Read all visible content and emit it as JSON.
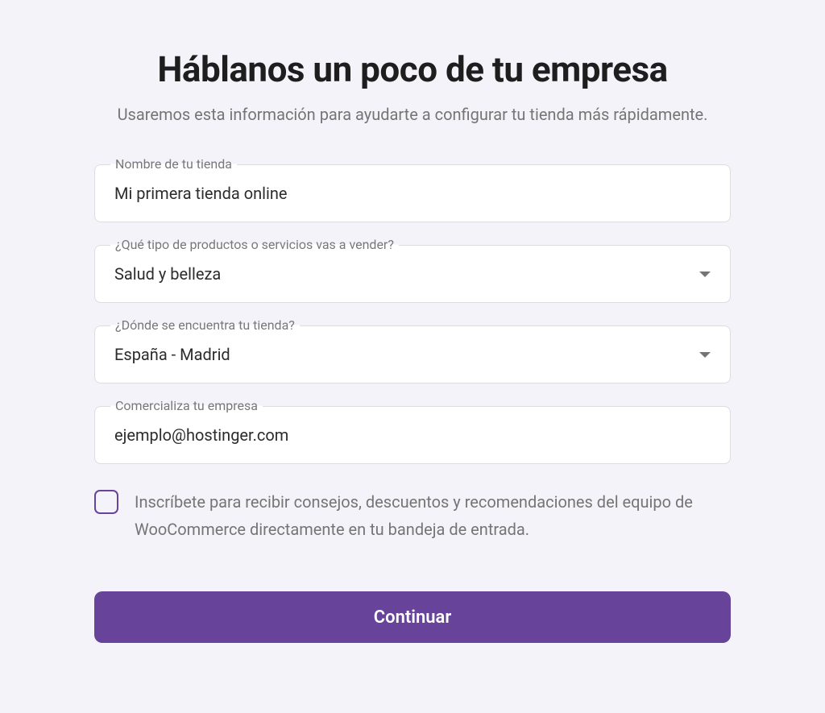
{
  "header": {
    "title": "Háblanos un poco de tu empresa",
    "subtitle": "Usaremos esta información para ayudarte a configurar tu tienda más rápidamente."
  },
  "form": {
    "storeName": {
      "label": "Nombre de tu tienda",
      "value": "Mi primera tienda online"
    },
    "productType": {
      "label": "¿Qué tipo de productos o servicios vas a vender?",
      "value": "Salud y belleza"
    },
    "location": {
      "label": "¿Dónde se encuentra tu tienda?",
      "value": "España - Madrid"
    },
    "email": {
      "label": "Comercializa tu empresa",
      "value": "ejemplo@hostinger.com"
    },
    "checkbox": {
      "label": "Inscríbete para recibir consejos, descuentos y recomendaciones del equipo de WooCommerce directamente en tu bandeja de entrada."
    },
    "continueButton": "Continuar"
  }
}
